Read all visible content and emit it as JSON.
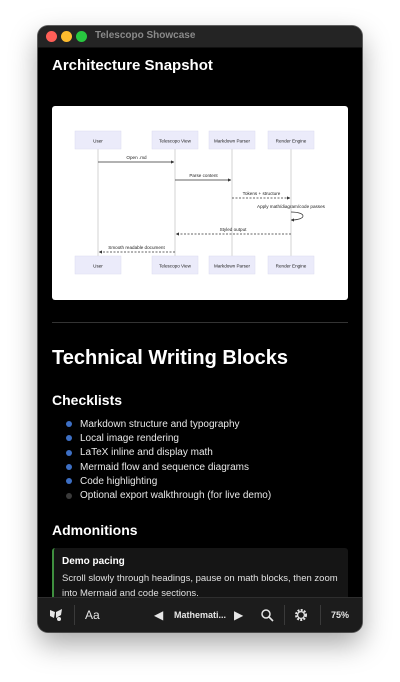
{
  "window": {
    "title": "Telescopo Showcase"
  },
  "section1": {
    "heading": "Architecture Snapshot"
  },
  "diagram": {
    "participants": [
      "User",
      "Telescopo View",
      "Markdown Parser",
      "Render Engine"
    ],
    "messages": [
      {
        "label": "Open .md",
        "style": "solid"
      },
      {
        "label": "Parse content",
        "style": "solid"
      },
      {
        "label": "Tokens + structure",
        "style": "dashed"
      },
      {
        "label": "Apply math/diagram/code passes",
        "style": "solid"
      },
      {
        "label": "Styled output",
        "style": "dashed"
      },
      {
        "label": "Smooth readable document",
        "style": "dashed"
      }
    ]
  },
  "section2": {
    "heading": "Technical Writing Blocks"
  },
  "checklists": {
    "heading": "Checklists",
    "items": [
      {
        "label": "Markdown structure and typography",
        "checked": true
      },
      {
        "label": "Local image rendering",
        "checked": true
      },
      {
        "label": "LaTeX inline and display math",
        "checked": true
      },
      {
        "label": "Mermaid flow and sequence diagrams",
        "checked": true
      },
      {
        "label": "Code highlighting",
        "checked": true
      },
      {
        "label": "Optional export walkthrough (for live demo)",
        "checked": false
      }
    ]
  },
  "admonitions": {
    "heading": "Admonitions",
    "callout": {
      "title": "Demo pacing",
      "line1": "Scroll slowly through headings, pause on math blocks, then zoom",
      "line2": "into Mermaid and code sections."
    }
  },
  "toolbar": {
    "font_label": "Aa",
    "section_label": "Mathemati...",
    "zoom": "75%"
  },
  "colors": {
    "checked_dot": "#3d6fc4",
    "unchecked_dot": "#3a3a3a",
    "admonition_border": "#3f8f3f",
    "participant_box": "#ebebfa"
  }
}
